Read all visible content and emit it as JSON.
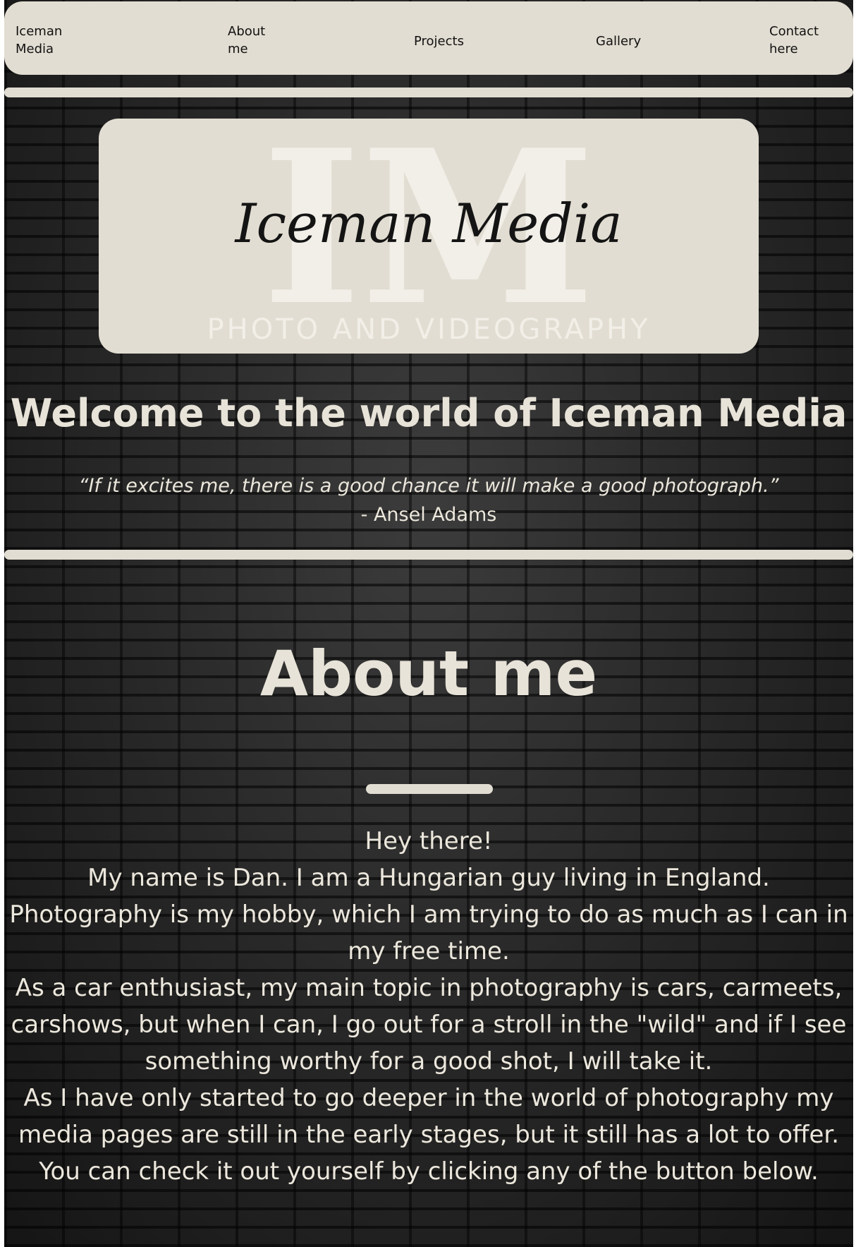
{
  "nav": {
    "brand": "Iceman Media",
    "about": "About me",
    "projects": "Projects",
    "gallery": "Gallery",
    "contact": "Contact here"
  },
  "logo": {
    "monogram": "IM",
    "script_text": "Iceman Media",
    "tagline": "PHOTO AND VIDEOGRAPHY"
  },
  "hero": {
    "title": "Welcome to the world of Iceman Media",
    "quote": "“If it excites me, there is a good chance it will make a good photograph.”",
    "author": "- Ansel Adams"
  },
  "about": {
    "title": "About me",
    "paragraphs": [
      "Hey there!",
      "My name is Dan. I am a Hungarian guy living in England.",
      "Photography is my hobby, which I am trying to do as much as I can in my free time.",
      "As a car enthusiast, my main topic in photography is cars, carmeets, carshows, but when I can, I go out for a stroll in the \"wild\" and if I see something worthy for a good shot, I will take it.",
      "As I have only started to go deeper in the world of photography my media pages are still in the early stages, but it still has a lot to offer.",
      "You can check it out yourself by clicking any of the button below."
    ]
  },
  "colors": {
    "accent": "#e2ddd2",
    "text_light": "#ece7dc",
    "nav_text": "#111111",
    "background": "#262626"
  }
}
